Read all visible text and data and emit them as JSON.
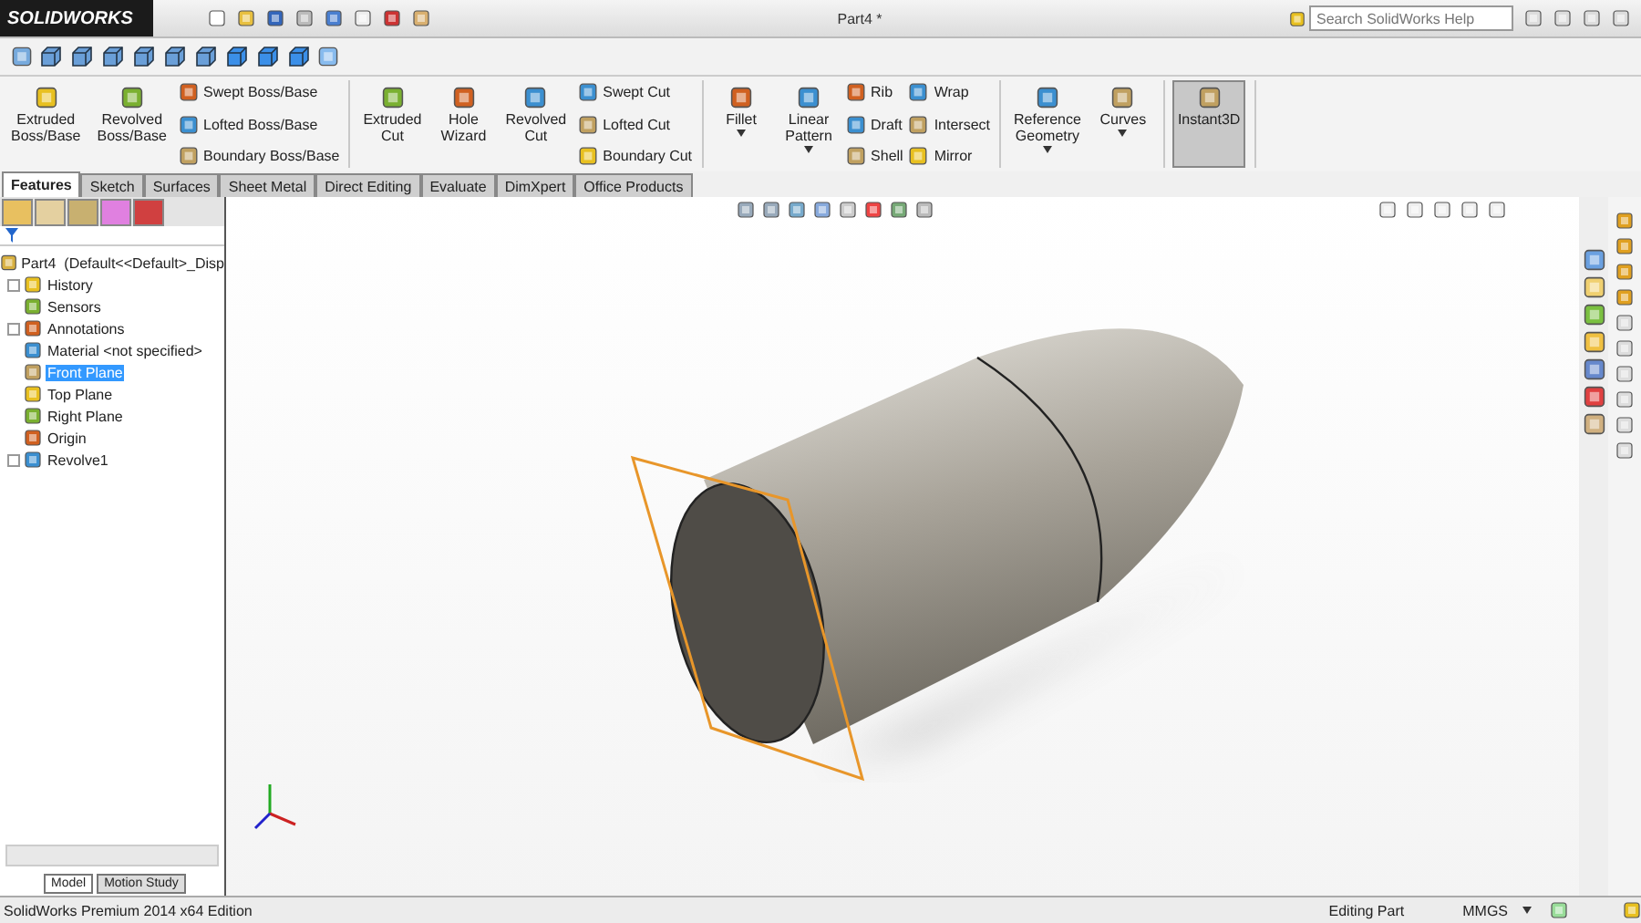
{
  "app": {
    "logo": "SOLIDWORKS",
    "title": "Part4 *",
    "search_placeholder": "Search SolidWorks Help"
  },
  "command_groups": [
    {
      "columns": [
        {
          "kind": "large",
          "label": "Extruded\nBoss/Base",
          "dropdown": false,
          "pressed": false
        },
        {
          "kind": "large",
          "label": "Revolved\nBoss/Base",
          "dropdown": false,
          "pressed": false
        },
        {
          "kind": "stack",
          "items": [
            "Swept Boss/Base",
            "Lofted Boss/Base",
            "Boundary Boss/Base"
          ]
        }
      ]
    },
    {
      "columns": [
        {
          "kind": "large",
          "label": "Extruded\nCut",
          "dropdown": false,
          "pressed": false
        },
        {
          "kind": "large",
          "label": "Hole\nWizard",
          "dropdown": false,
          "pressed": false
        },
        {
          "kind": "large",
          "label": "Revolved\nCut",
          "dropdown": false,
          "pressed": false
        },
        {
          "kind": "stack",
          "items": [
            "Swept Cut",
            "Lofted Cut",
            "Boundary Cut"
          ]
        }
      ]
    },
    {
      "columns": [
        {
          "kind": "large",
          "label": "Fillet",
          "dropdown": true,
          "pressed": false
        },
        {
          "kind": "large",
          "label": "Linear\nPattern",
          "dropdown": true,
          "pressed": false
        },
        {
          "kind": "stack",
          "items": [
            "Rib",
            "Draft",
            "Shell"
          ]
        },
        {
          "kind": "stack",
          "items": [
            "Wrap",
            "Intersect",
            "Mirror"
          ]
        }
      ]
    },
    {
      "columns": [
        {
          "kind": "large",
          "label": "Reference\nGeometry",
          "dropdown": true,
          "pressed": false
        },
        {
          "kind": "large",
          "label": "Curves",
          "dropdown": true,
          "pressed": false
        }
      ]
    },
    {
      "columns": [
        {
          "kind": "large",
          "label": "Instant3D",
          "dropdown": false,
          "pressed": true
        }
      ]
    }
  ],
  "tabs": [
    {
      "label": "Features",
      "selected": true
    },
    {
      "label": "Sketch",
      "selected": false
    },
    {
      "label": "Surfaces",
      "selected": false
    },
    {
      "label": "Sheet Metal",
      "selected": false
    },
    {
      "label": "Direct Editing",
      "selected": false
    },
    {
      "label": "Evaluate",
      "selected": false
    },
    {
      "label": "DimXpert",
      "selected": false
    },
    {
      "label": "Office Products",
      "selected": false
    }
  ],
  "tree": {
    "root": "Part4  (Default<<Default>_Disp",
    "items": [
      {
        "label": "History",
        "expandable": true,
        "selected": false
      },
      {
        "label": "Sensors",
        "expandable": false,
        "selected": false
      },
      {
        "label": "Annotations",
        "expandable": true,
        "selected": false
      },
      {
        "label": "Material <not specified>",
        "expandable": false,
        "selected": false
      },
      {
        "label": "Front Plane",
        "expandable": false,
        "selected": true
      },
      {
        "label": "Top Plane",
        "expandable": false,
        "selected": false
      },
      {
        "label": "Right Plane",
        "expandable": false,
        "selected": false
      },
      {
        "label": "Origin",
        "expandable": false,
        "selected": false
      },
      {
        "label": "Revolve1",
        "expandable": true,
        "selected": false
      }
    ]
  },
  "bottom_tabs": [
    {
      "label": "Model",
      "selected": true
    },
    {
      "label": "Motion Study",
      "selected": false
    }
  ],
  "status_bar": {
    "edition": "SolidWorks Premium 2014 x64 Edition",
    "mode": "Editing Part",
    "units": "MMGS"
  }
}
